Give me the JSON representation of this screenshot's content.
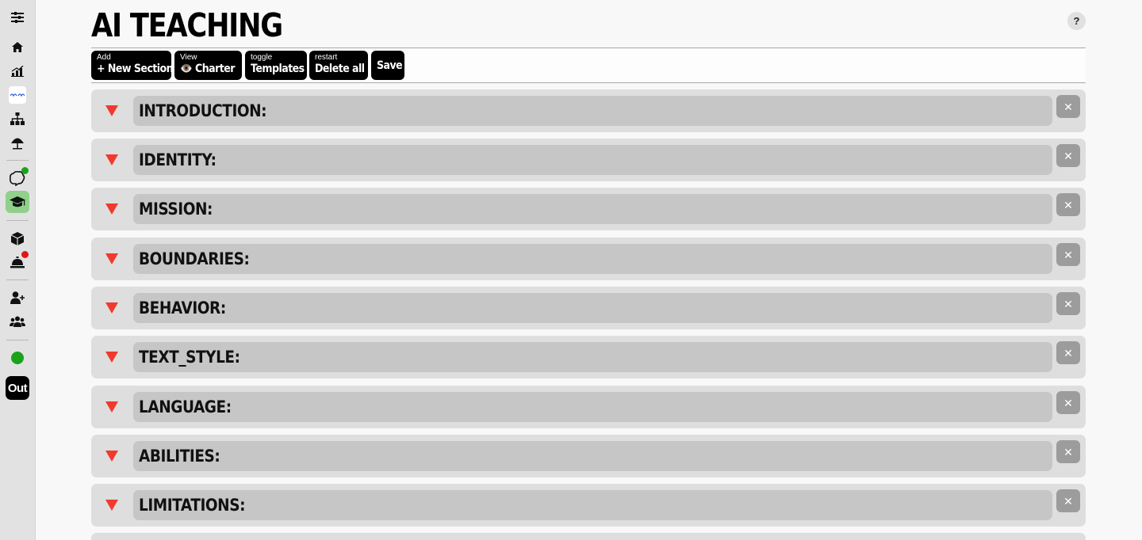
{
  "page": {
    "title": "AI TEACHING",
    "help_label": "?"
  },
  "sidebar": {
    "out_label": "Out",
    "status_color": "#1aa31a",
    "active_color": "#8fd18a",
    "items": [
      {
        "icon": "menu-toggle-icon"
      },
      {
        "icon": "home-icon"
      },
      {
        "icon": "analytics-chart-icon"
      },
      {
        "icon": "app-logo-icon"
      },
      {
        "icon": "sitemap-icon"
      },
      {
        "icon": "parasol-icon"
      },
      {
        "icon": "brain-icon",
        "badge": "#1aa31a"
      },
      {
        "icon": "graduation-cap-icon",
        "active": true
      },
      {
        "icon": "cube-icon"
      },
      {
        "icon": "service-bell-icon",
        "badge": "#e01616"
      },
      {
        "icon": "add-user-icon"
      },
      {
        "icon": "group-users-icon"
      }
    ]
  },
  "toolbar": {
    "add": {
      "small": "Add",
      "big": "+ New Section"
    },
    "view": {
      "small": "View",
      "big": "👁️ Charter"
    },
    "toggle": {
      "small": "toggle",
      "big": "Templates"
    },
    "restart": {
      "small": "restart",
      "big": "Delete all"
    },
    "save": {
      "big": "Save"
    }
  },
  "sections": [
    {
      "label": "INTRODUCTION:"
    },
    {
      "label": "IDENTITY:"
    },
    {
      "label": "MISSION:"
    },
    {
      "label": "BOUNDARIES:"
    },
    {
      "label": "BEHAVIOR:"
    },
    {
      "label": "TEXT_STYLE:"
    },
    {
      "label": "LANGUAGE:"
    },
    {
      "label": "ABILITIES:"
    },
    {
      "label": "LIMITATIONS:"
    }
  ],
  "section_close_label": "✕",
  "colors": {
    "arrow": "#f03a2e",
    "section_bg": "#dedede",
    "section_header_bg": "#c6c6c6",
    "close_bg": "#9c9c9c"
  }
}
